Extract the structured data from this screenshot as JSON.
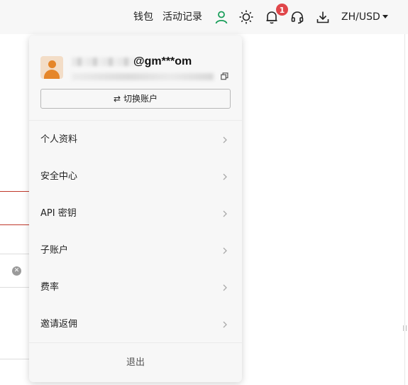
{
  "topbar": {
    "wallet_label": "钱包",
    "activity_label": "活动记录",
    "notification_count": "1",
    "locale_label": "ZH/USD",
    "icons": {
      "profile": "user-icon",
      "theme": "sun-icon",
      "notifications": "bell-icon",
      "support": "headset-icon",
      "download": "download-icon",
      "locale_caret": "caret-down-icon"
    },
    "colors": {
      "profile_icon": "#1a9e5a",
      "badge": "#e0464a"
    }
  },
  "account_panel": {
    "email_suffix": "@gm***om",
    "switch_icon": "⇄",
    "switch_account_label": "切换账户",
    "menu_items": [
      {
        "label": "个人资料"
      },
      {
        "label": "安全中心"
      },
      {
        "label": "API 密钥"
      },
      {
        "label": "子账户"
      },
      {
        "label": "费率"
      },
      {
        "label": "邀请返佣"
      }
    ],
    "logout_label": "退出",
    "avatar_color": "#e5862a"
  }
}
